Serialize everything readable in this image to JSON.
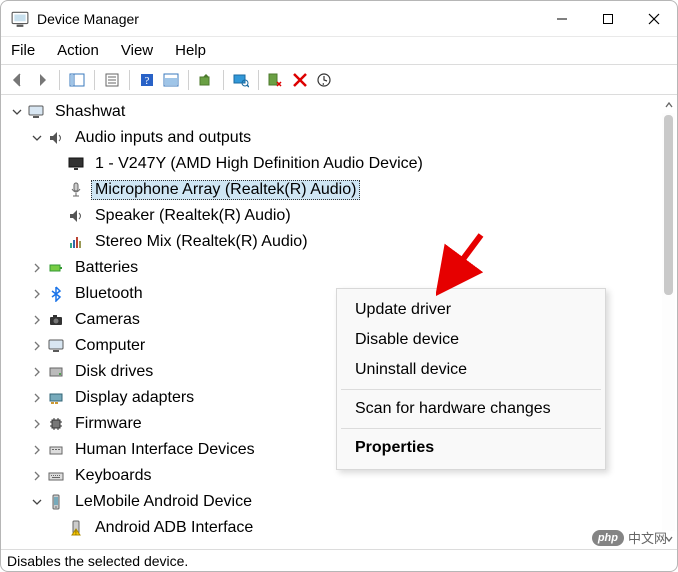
{
  "window": {
    "title": "Device Manager"
  },
  "menubar": {
    "items": [
      "File",
      "Action",
      "View",
      "Help"
    ]
  },
  "tree": {
    "root": "Shashwat",
    "category_audio": "Audio inputs and outputs",
    "dev_v247y": "1 - V247Y (AMD High Definition Audio Device)",
    "dev_mic": "Microphone Array (Realtek(R) Audio)",
    "dev_speaker": "Speaker (Realtek(R) Audio)",
    "dev_stereo": "Stereo Mix (Realtek(R) Audio)",
    "category_batteries": "Batteries",
    "category_bluetooth": "Bluetooth",
    "category_cameras": "Cameras",
    "category_computer": "Computer",
    "category_disks": "Disk drives",
    "category_display": "Display adapters",
    "category_firmware": "Firmware",
    "category_hid": "Human Interface Devices",
    "category_keyboards": "Keyboards",
    "category_lemobile": "LeMobile Android Device",
    "dev_android_adb": "Android ADB Interface"
  },
  "context_menu": {
    "update": "Update driver",
    "disable": "Disable device",
    "uninstall": "Uninstall device",
    "scan": "Scan for hardware changes",
    "properties": "Properties"
  },
  "statusbar": {
    "text": "Disables the selected device."
  },
  "watermark": {
    "logo": "php",
    "text": "中文网"
  }
}
